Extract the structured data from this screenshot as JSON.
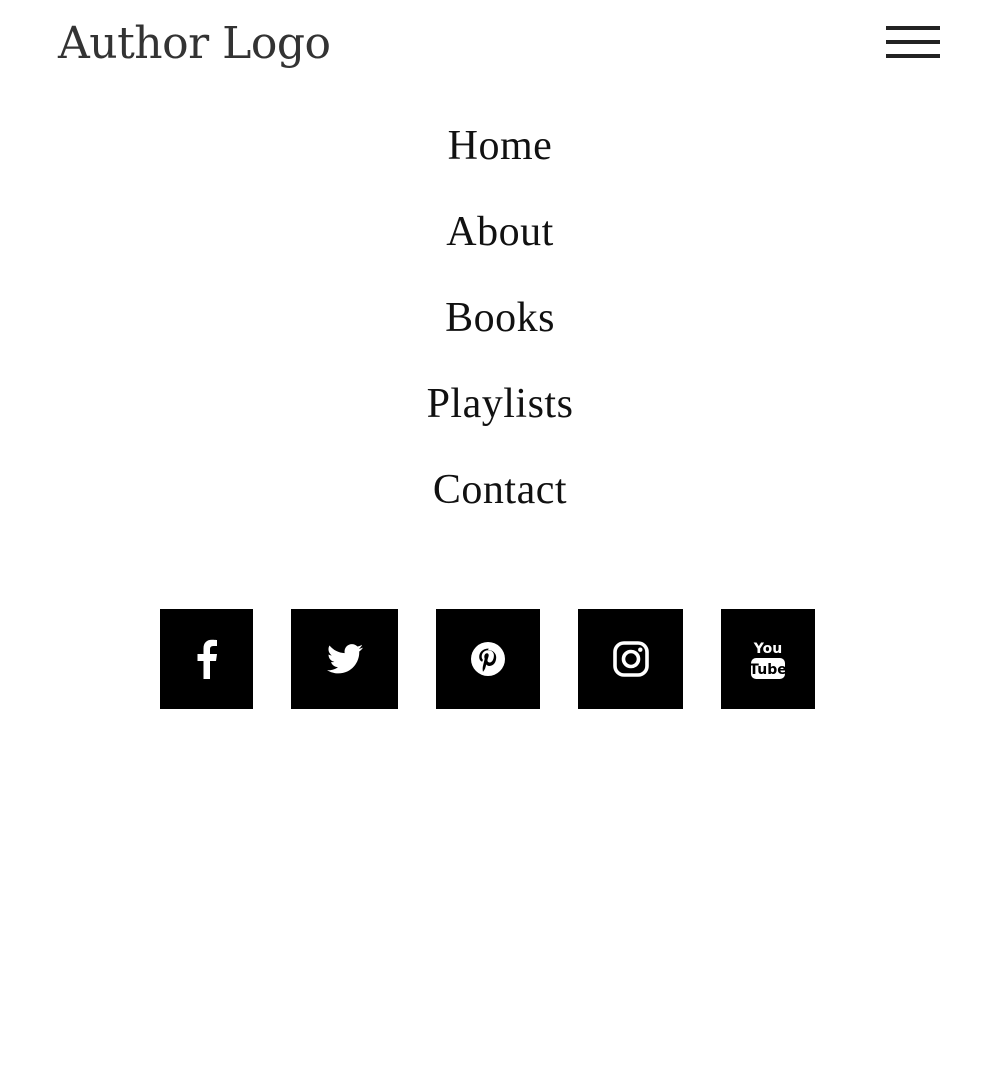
{
  "header": {
    "logo_text": "Author Logo",
    "menu_icon": "hamburger-menu-icon"
  },
  "nav": {
    "items": [
      {
        "label": "Home"
      },
      {
        "label": "About"
      },
      {
        "label": "Books"
      },
      {
        "label": "Playlists"
      },
      {
        "label": "Contact"
      }
    ]
  },
  "social": {
    "icons": [
      "facebook-icon",
      "twitter-icon",
      "pinterest-icon",
      "instagram-icon",
      "youtube-icon"
    ],
    "youtube_text_top": "You",
    "youtube_text_bottom": "Tube"
  },
  "colors": {
    "background": "#ffffff",
    "text": "#111111",
    "logo": "#333333",
    "social_tile": "#000000",
    "social_glyph": "#ffffff"
  }
}
